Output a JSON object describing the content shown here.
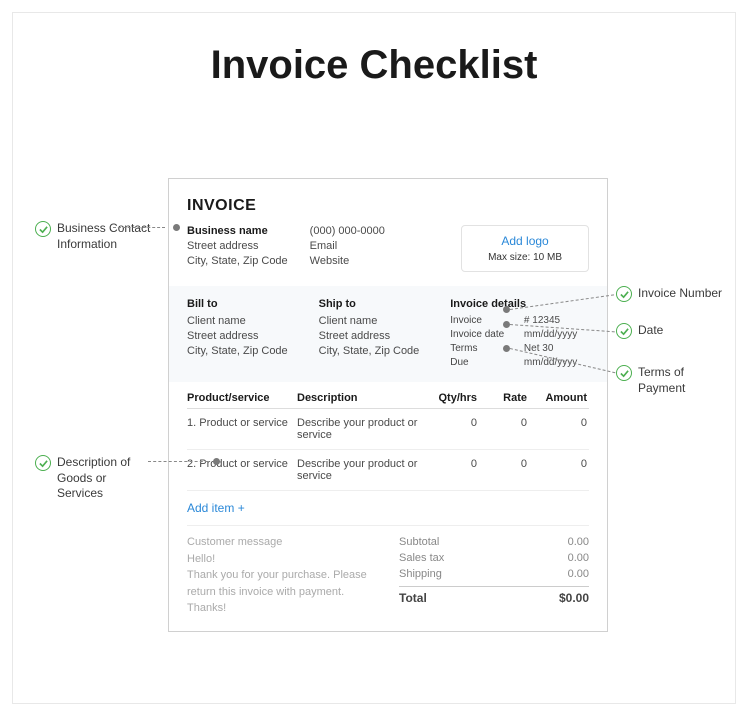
{
  "title": "Invoice Checklist",
  "invoice": {
    "heading": "INVOICE",
    "business": {
      "name": "Business name",
      "street": "Street address",
      "csz": "City, State, Zip Code",
      "phone": "(000) 000-0000",
      "email": "Email",
      "website": "Website"
    },
    "logo": {
      "add": "Add logo",
      "max": "Max size: 10 MB"
    },
    "billto": {
      "head": "Bill to",
      "client": "Client name",
      "street": "Street address",
      "csz": "City, State, Zip Code"
    },
    "shipto": {
      "head": "Ship to",
      "client": "Client name",
      "street": "Street address",
      "csz": "City, State, Zip Code"
    },
    "details": {
      "head": "Invoice details",
      "inv_label": "Invoice",
      "inv_val": "# 12345",
      "date_label": "Invoice date",
      "date_val": "mm/dd/yyyy",
      "terms_label": "Terms",
      "terms_val": "Net 30",
      "due_label": "Due",
      "due_val": "mm/dd/yyyy"
    },
    "cols": {
      "c1": "Product/service",
      "c2": "Description",
      "c3": "Qty/hrs",
      "c4": "Rate",
      "c5": "Amount"
    },
    "rows": [
      {
        "n": "1.",
        "prod": "Product or service",
        "desc": "Describe your product or service",
        "qty": "0",
        "rate": "0",
        "amt": "0"
      },
      {
        "n": "2.",
        "prod": "Product or service",
        "desc": "Describe your product or service",
        "qty": "0",
        "rate": "0",
        "amt": "0"
      }
    ],
    "additem": "Add item +",
    "message": {
      "head": "Customer message",
      "greet": "Hello!",
      "body": "Thank you for your purchase. Please return this invoice with payment.",
      "signoff": "Thanks!"
    },
    "totals": {
      "subtotal_l": "Subtotal",
      "subtotal_v": "0.00",
      "tax_l": "Sales tax",
      "tax_v": "0.00",
      "ship_l": "Shipping",
      "ship_v": "0.00",
      "total_l": "Total",
      "total_v": "$0.00"
    }
  },
  "callouts": {
    "biz": "Business Contact Information",
    "invno": "Invoice Number",
    "date": "Date",
    "terms": "Terms of Payment",
    "desc": "Description of Goods or Services"
  }
}
